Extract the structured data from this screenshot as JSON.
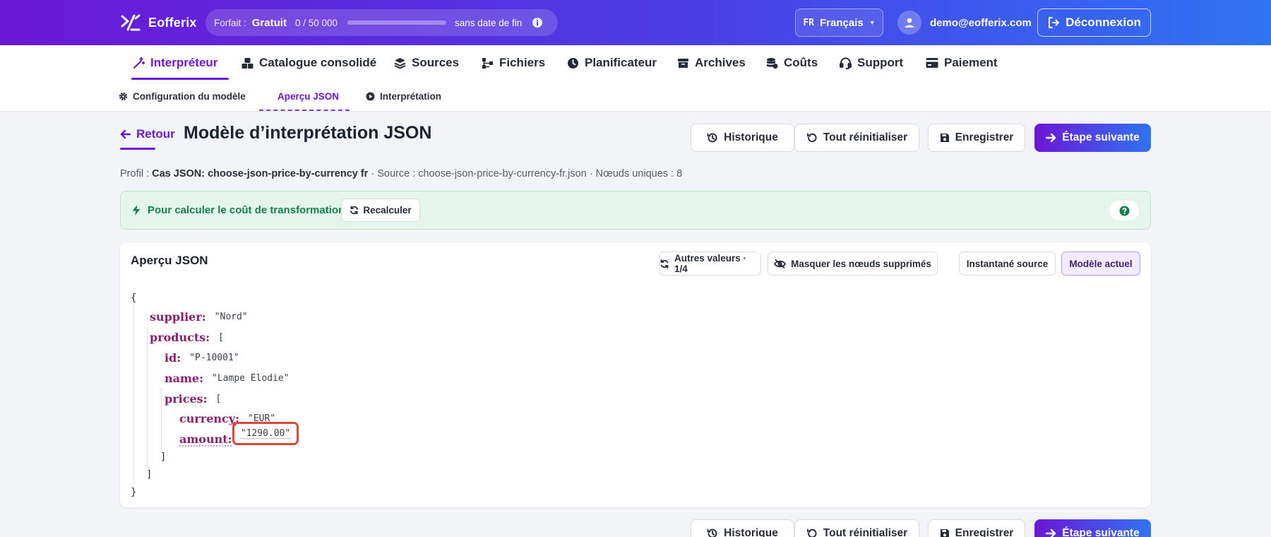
{
  "header": {
    "brand": "Eofferix",
    "plan_label": "Forfait :",
    "plan_value": "Gratuit",
    "usage_text": "0 / 50 000",
    "usage_fraction": 0,
    "plan_end": "sans date de fin",
    "lang_code": "FR",
    "lang_name": "Français",
    "user_email": "demo@eofferix.com",
    "logout_label": "Déconnexion"
  },
  "nav": {
    "items": [
      {
        "label": "Interpréteur",
        "icon": "magic-wand-icon",
        "active": true
      },
      {
        "label": "Catalogue consolidé",
        "icon": "boxes-icon"
      },
      {
        "label": "Sources",
        "icon": "layers-icon"
      },
      {
        "label": "Fichiers",
        "icon": "sitemap-icon"
      },
      {
        "label": "Planificateur",
        "icon": "clock-icon"
      },
      {
        "label": "Archives",
        "icon": "archive-icon"
      },
      {
        "label": "Coûts",
        "icon": "coins-icon"
      },
      {
        "label": "Support",
        "icon": "headset-icon"
      },
      {
        "label": "Paiement",
        "icon": "credit-card-icon"
      }
    ]
  },
  "subnav": {
    "items": [
      {
        "label": "Configuration du modèle",
        "icon": "gear-icon"
      },
      {
        "label": "Aperçu JSON",
        "active": true
      },
      {
        "label": "Interprétation",
        "icon": "play-circle-icon"
      }
    ]
  },
  "page": {
    "back_label": "Retour",
    "title": "Modèle d’interprétation JSON",
    "actions": {
      "history": "Historique",
      "reset": "Tout réinitialiser",
      "save": "Enregistrer",
      "next": "Étape suivante"
    },
    "profile_prefix": "Profil :",
    "profile_name": "Cas JSON: choose-json-price-by-currency fr",
    "profile_rest": "· Source : choose-json-price-by-currency-fr.json · Nœuds uniques : 8"
  },
  "alert": {
    "text": "Pour calculer le coût de transformation",
    "recalc_label": "Recalculer",
    "colors": {
      "background": "#e4f5ec",
      "text": "#16804a"
    }
  },
  "json_card": {
    "title": "Aperçu JSON",
    "chips": {
      "other_values": "Autres valeurs · 1/4",
      "hide_deleted": "Masquer les nœuds supprimés",
      "source_snapshot": "Instantané source",
      "current_model": "Modèle actuel"
    },
    "tree": {
      "open_root": "{",
      "close_root": "}",
      "supplier_key": "supplier:",
      "supplier_val": "\"Nord\"",
      "products_key": "products:",
      "open_products": "[",
      "close_products": "]",
      "id_key": "id:",
      "id_val": "\"P-10001\"",
      "name_key": "name:",
      "name_val": "\"Lampe Elodie\"",
      "prices_key": "prices:",
      "open_prices": "[",
      "close_prices": "]",
      "currency_key": "currency:",
      "currency_val": "\"EUR\"",
      "amount_key": "amount:",
      "amount_val": "\"1290.00\""
    }
  },
  "colors": {
    "accent": "#6a19d6",
    "gradient_end": "#2f74f2",
    "json_key": "#8a1f6d",
    "highlight": "#d6473d"
  }
}
